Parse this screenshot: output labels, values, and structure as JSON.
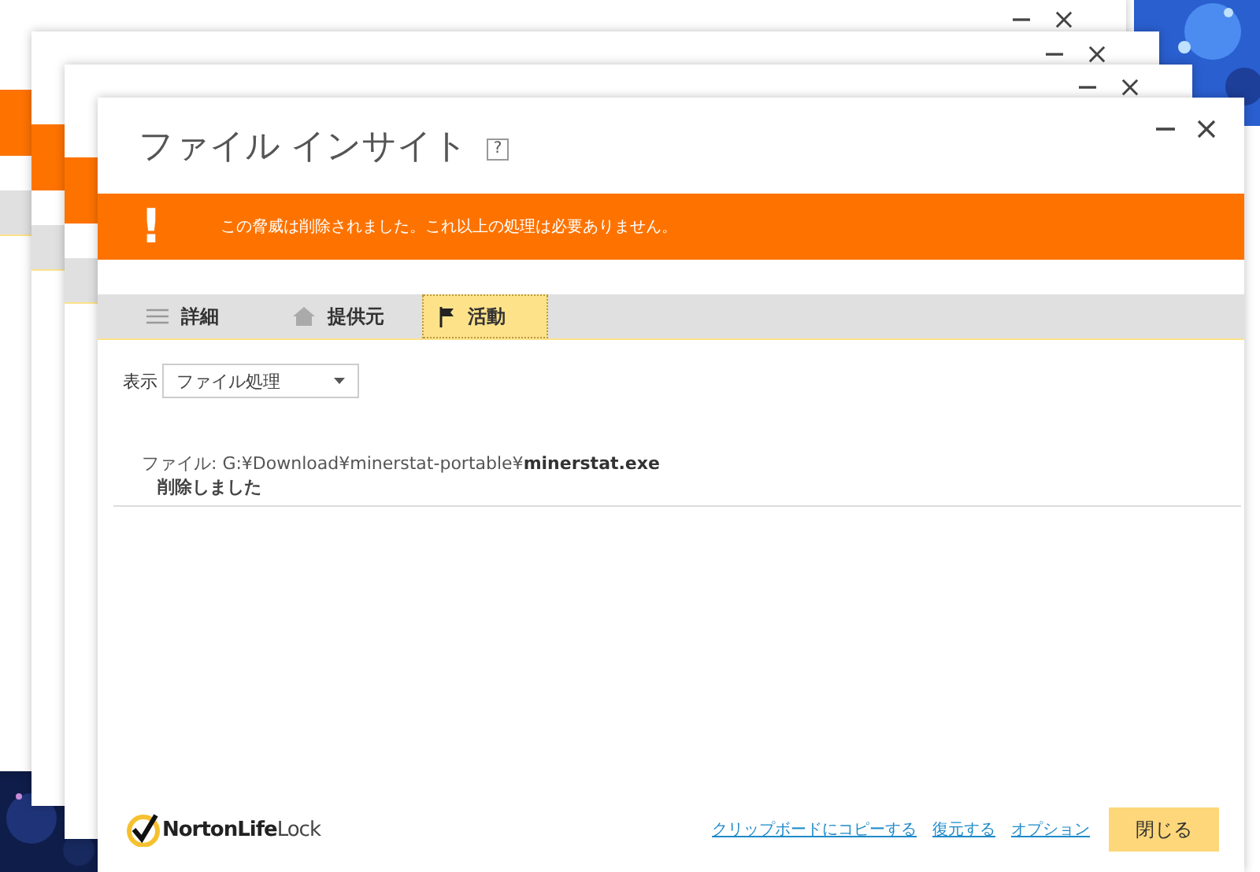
{
  "background_windows": [
    {
      "kind": "window"
    },
    {
      "kind": "window"
    },
    {
      "kind": "window"
    }
  ],
  "window": {
    "title": "ファイル インサイト",
    "help": "?"
  },
  "banner": {
    "icon": "!",
    "message": "この脅威は削除されました。これ以上の処理は必要ありません。"
  },
  "tabs": [
    {
      "label": "詳細",
      "kind": "list",
      "selected": false
    },
    {
      "label": "提供元",
      "kind": "home",
      "selected": false
    },
    {
      "label": "活動",
      "kind": "flag",
      "selected": true
    }
  ],
  "view": {
    "label": "表示",
    "value": "ファイル処理"
  },
  "entries": [
    {
      "file": "ファイル: G:¥Download¥minerstat-portable¥**minerstat.exe**",
      "action": "削除しました"
    }
  ],
  "footer": {
    "logo": {
      "bold": "NortonLife",
      "light": "Lock"
    },
    "links": [
      "クリップボードにコピーする",
      "復元する",
      "オプション"
    ],
    "button": "閉じる"
  }
}
